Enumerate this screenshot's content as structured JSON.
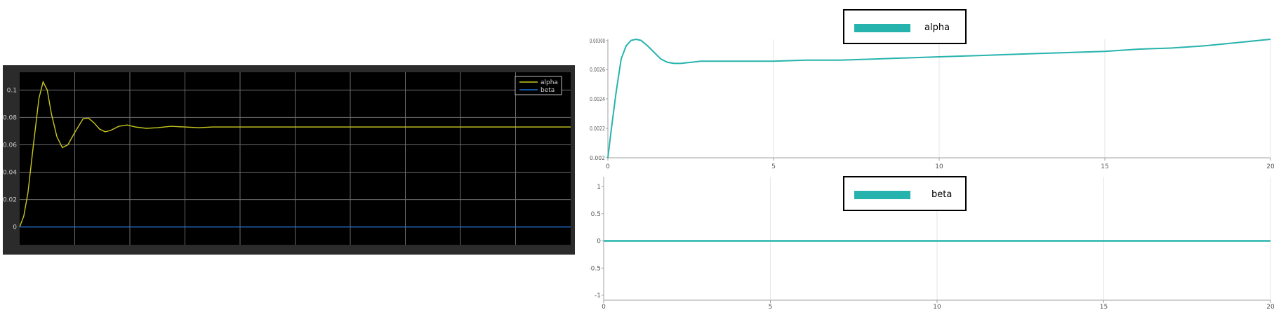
{
  "colors": {
    "scope_bg": "#000000",
    "scope_frame": "#2b2b2b",
    "scope_grid": "#6b6b6b",
    "scope_text": "#cfcfcf",
    "alpha_line": "#c8c81e",
    "beta_line": "#1e6fd9",
    "teal": "#27b3ad",
    "axis": "#a0a0a0",
    "grid_light": "#e6e6e6",
    "tick_text": "#555555"
  },
  "chart_data": [
    {
      "type": "line",
      "xlim": [
        0,
        20
      ],
      "ylim": [
        -0.013,
        0.113
      ],
      "grid": true,
      "legend_position": "top-right",
      "x_grid": [
        2,
        4,
        6,
        8,
        10,
        12,
        14,
        16,
        18
      ],
      "y_ticks": [
        0,
        0.02,
        0.04,
        0.06,
        0.08,
        0.1
      ],
      "y_tick_labels": [
        "0",
        "0.02",
        "0.04",
        "0.06",
        "0.08",
        "0.1"
      ],
      "series": [
        {
          "name": "alpha",
          "x": [
            0,
            0.15,
            0.3,
            0.5,
            0.7,
            0.85,
            1.0,
            1.15,
            1.35,
            1.55,
            1.75,
            2.0,
            2.3,
            2.5,
            2.7,
            2.9,
            3.1,
            3.3,
            3.6,
            3.9,
            4.2,
            4.6,
            5.0,
            5.5,
            6.0,
            6.5,
            7,
            8,
            9,
            10,
            12,
            14,
            16,
            18,
            20
          ],
          "y": [
            0,
            0.008,
            0.025,
            0.06,
            0.094,
            0.106,
            0.1,
            0.083,
            0.066,
            0.058,
            0.06,
            0.069,
            0.079,
            0.0795,
            0.076,
            0.0715,
            0.0695,
            0.0705,
            0.0735,
            0.0745,
            0.073,
            0.072,
            0.0725,
            0.0735,
            0.073,
            0.0725,
            0.073,
            0.073,
            0.073,
            0.073,
            0.073,
            0.073,
            0.073,
            0.073,
            0.073
          ]
        },
        {
          "name": "beta",
          "x": [
            0,
            20
          ],
          "y": [
            0,
            0
          ]
        }
      ]
    },
    {
      "type": "line",
      "legend": "alpha",
      "xlim": [
        0,
        20
      ],
      "ylim": [
        0.002,
        0.00308
      ],
      "x_ticks": [
        0,
        5,
        10,
        15,
        20
      ],
      "y_tick_labels": [
        "0.002",
        "0.0022",
        "0.0024",
        "0.0026",
        "0.00300"
      ],
      "series": [
        {
          "name": "alpha",
          "x": [
            0,
            0.1,
            0.25,
            0.4,
            0.55,
            0.7,
            0.85,
            1.0,
            1.2,
            1.4,
            1.6,
            1.8,
            2.0,
            2.2,
            2.5,
            2.8,
            3.2,
            3.6,
            4.0,
            5,
            6,
            7,
            8,
            9,
            10,
            11,
            12,
            13,
            14,
            15,
            16,
            17,
            18,
            19,
            20
          ],
          "y": [
            0.002,
            0.00225,
            0.0026,
            0.0029,
            0.00302,
            0.00307,
            0.00308,
            0.00307,
            0.00302,
            0.00296,
            0.0029,
            0.00287,
            0.00286,
            0.00286,
            0.00287,
            0.00288,
            0.00288,
            0.00288,
            0.00288,
            0.00288,
            0.00289,
            0.00289,
            0.0029,
            0.00291,
            0.00292,
            0.00293,
            0.00294,
            0.00295,
            0.00296,
            0.00297,
            0.00299,
            0.003,
            0.00302,
            0.00305,
            0.00308
          ]
        }
      ]
    },
    {
      "type": "line",
      "legend": "beta",
      "xlim": [
        0,
        20
      ],
      "ylim": [
        -1,
        1
      ],
      "x_ticks": [
        0,
        5,
        10,
        15,
        20
      ],
      "y_ticks": [
        -1,
        -0.5,
        0,
        0.5,
        1
      ],
      "y_tick_labels": [
        "-1",
        "-0.5",
        "0",
        "0.5",
        "1"
      ],
      "series": [
        {
          "name": "beta",
          "x": [
            0,
            20
          ],
          "y": [
            0,
            0
          ]
        }
      ]
    }
  ]
}
